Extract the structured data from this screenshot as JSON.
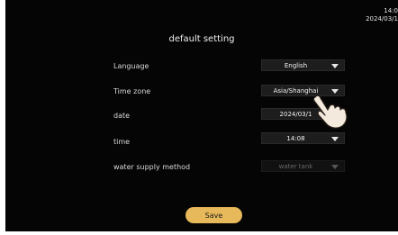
{
  "status": {
    "time": "14:0",
    "date": "2024/03/1"
  },
  "title": "default setting",
  "rows": [
    {
      "label": "Language",
      "value": "English"
    },
    {
      "label": "Time zone",
      "value": "Asia/Shanghai"
    },
    {
      "label": "date",
      "value": "2024/03/1"
    },
    {
      "label": "time",
      "value": "14:08"
    },
    {
      "label": "water supply method",
      "value": "water tank"
    }
  ],
  "save_label": "Save",
  "colors": {
    "accent": "#e8b95a",
    "background": "#050505",
    "field": "#1d1d1d"
  }
}
